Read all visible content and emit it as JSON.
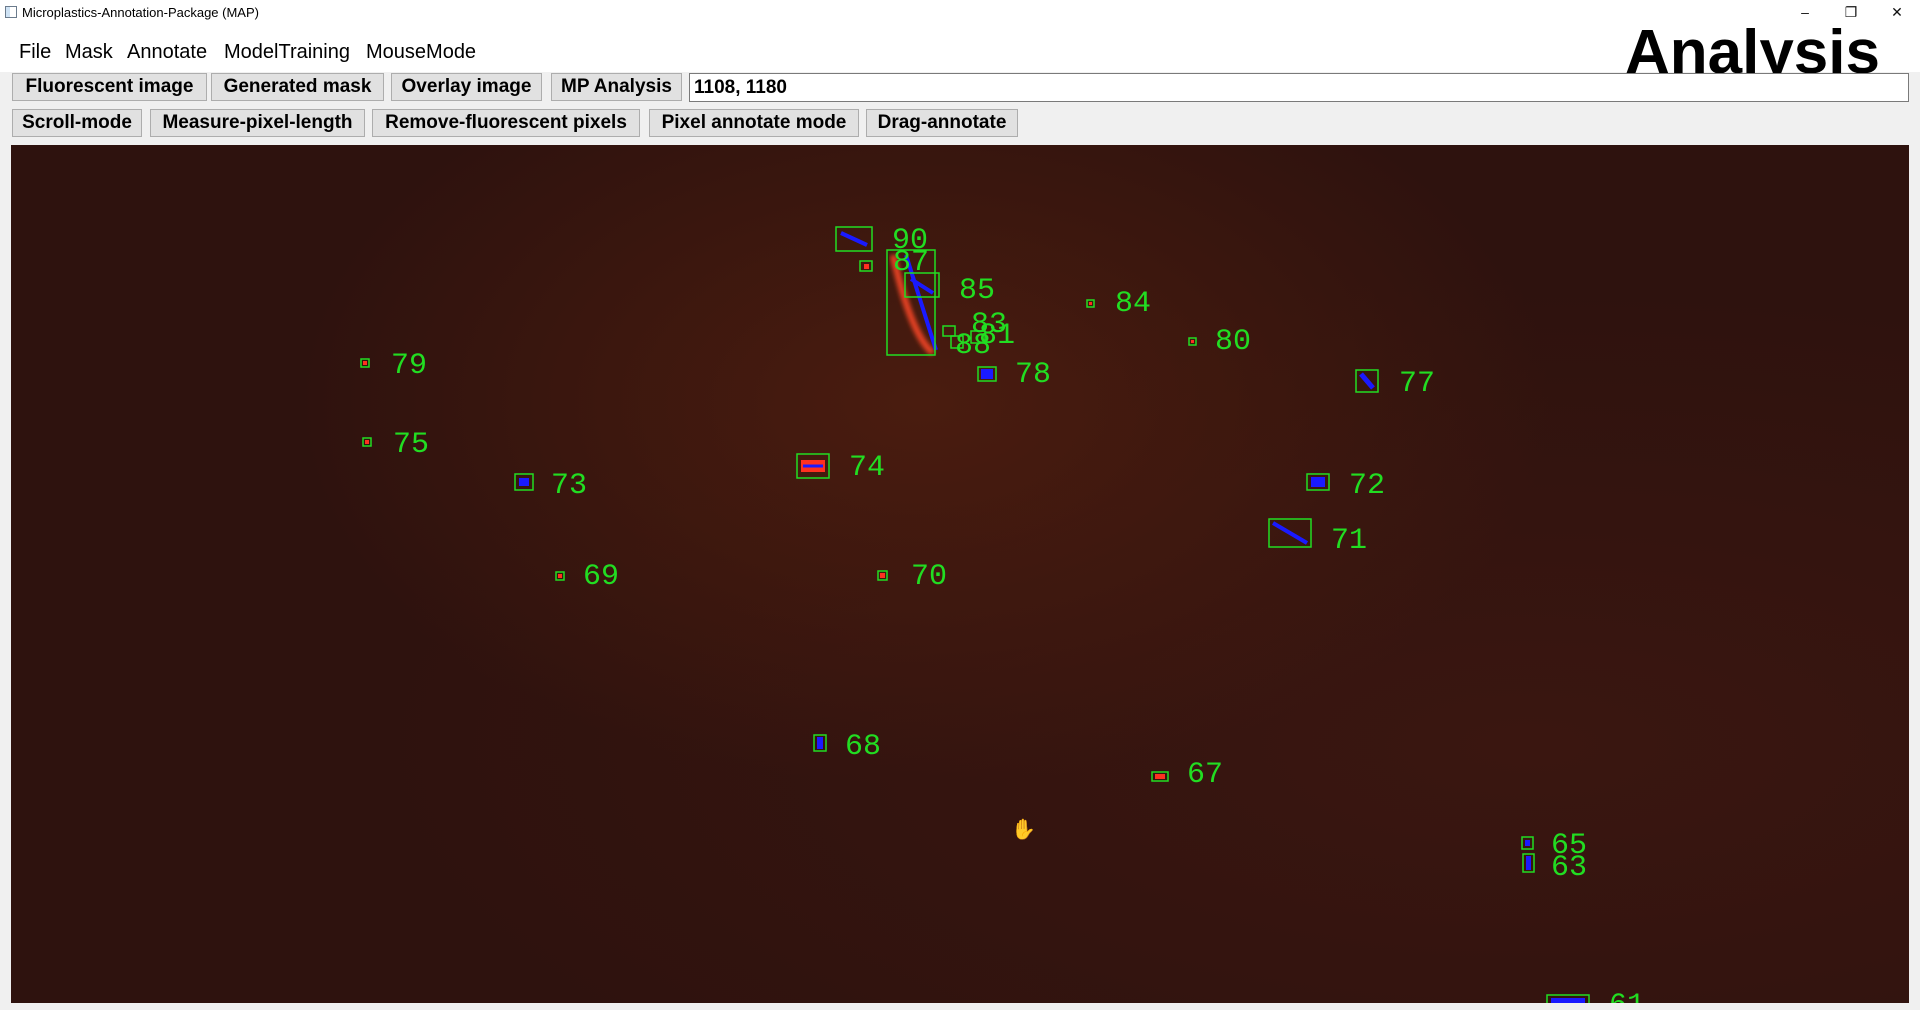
{
  "window": {
    "title": "Microplastics-Annotation-Package (MAP)"
  },
  "menu": [
    "File",
    "Mask",
    "Annotate",
    "ModelTraining",
    "MouseMode"
  ],
  "mode_title": "Analysis",
  "view_buttons": [
    "Fluorescent image",
    "Generated mask",
    "Overlay image",
    "MP Analysis"
  ],
  "coordinates_value": "1108, 1180",
  "mouse_mode_buttons": [
    "Scroll-mode",
    "Measure-pixel-length",
    "Remove-fluorescent pixels",
    "Pixel annotate mode",
    "Drag-annotate"
  ],
  "colors": {
    "annotation_box": "#22dd22",
    "particle_fill": "#1a1aff",
    "particle_edge": "#ff3020",
    "background": "#2e120e"
  },
  "cursor_icon": "hand-grab-icon",
  "annotations": [
    {
      "id": "90"
    },
    {
      "id": "87"
    },
    {
      "id": "85"
    },
    {
      "id": "84"
    },
    {
      "id": "83"
    },
    {
      "id": "81"
    },
    {
      "id": "88"
    },
    {
      "id": "80"
    },
    {
      "id": "79"
    },
    {
      "id": "78"
    },
    {
      "id": "77"
    },
    {
      "id": "75"
    },
    {
      "id": "74"
    },
    {
      "id": "73"
    },
    {
      "id": "72"
    },
    {
      "id": "71"
    },
    {
      "id": "70"
    },
    {
      "id": "69"
    },
    {
      "id": "68"
    },
    {
      "id": "67"
    },
    {
      "id": "65"
    },
    {
      "id": "63"
    },
    {
      "id": "61"
    }
  ]
}
